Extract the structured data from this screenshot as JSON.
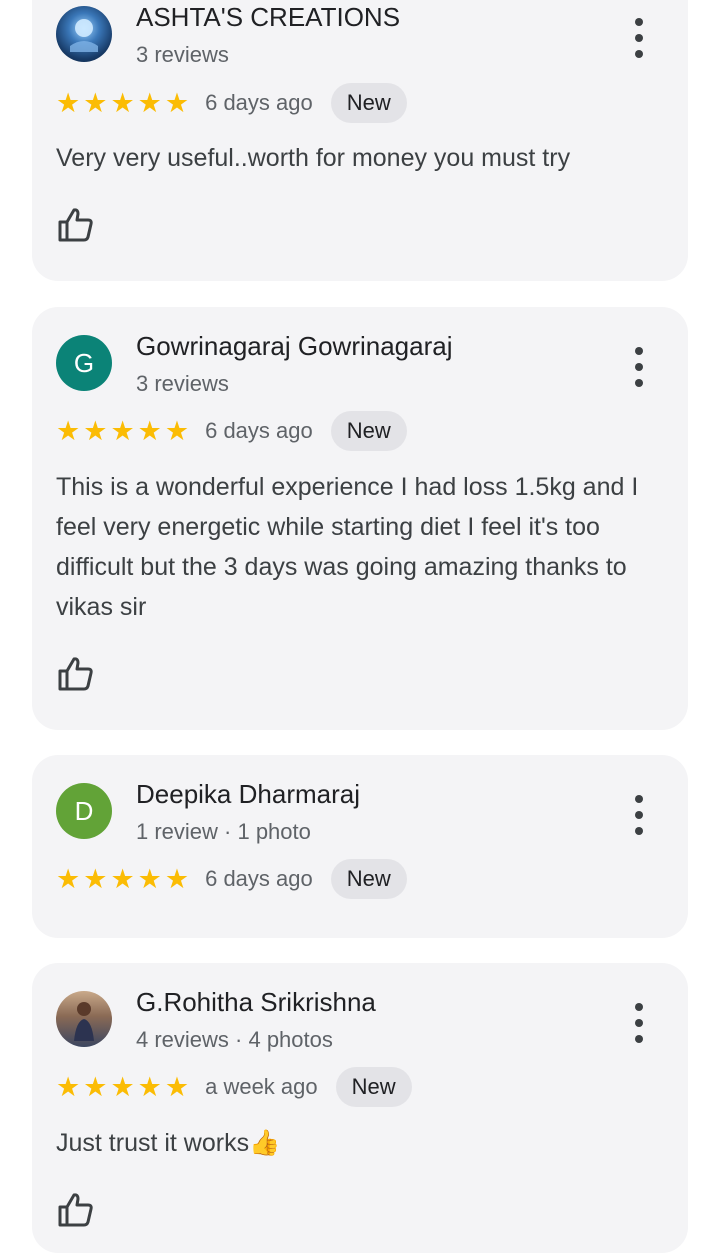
{
  "colors": {
    "star": "#fbbc04",
    "card_bg": "#f4f4f6",
    "badge_bg": "#e3e3e7",
    "avatar_g": "#0b8377",
    "avatar_d": "#62a337"
  },
  "reviews": [
    {
      "name": "ASHTA'S CREATIONS",
      "meta": "3 reviews",
      "avatar_type": "image",
      "avatar_letter": "",
      "stars": 5,
      "time": "6 days ago",
      "badge": "New",
      "text": "Very very useful..worth for money you must try"
    },
    {
      "name": "Gowrinagaraj Gowrinagaraj",
      "meta": "3 reviews",
      "avatar_type": "letter",
      "avatar_letter": "G",
      "stars": 5,
      "time": "6 days ago",
      "badge": "New",
      "text": "This is a wonderful experience I had loss 1.5kg and I feel very energetic while starting diet I feel it's too difficult but the 3 days was going amazing thanks to vikas sir"
    },
    {
      "name": "Deepika Dharmaraj",
      "meta": "1 review · 1 photo",
      "avatar_type": "letter",
      "avatar_letter": "D",
      "stars": 5,
      "time": "6 days ago",
      "badge": "New",
      "text": ""
    },
    {
      "name": "G.Rohitha Srikrishna",
      "meta": "4 reviews · 4 photos",
      "avatar_type": "image",
      "avatar_letter": "",
      "stars": 5,
      "time": "a week ago",
      "badge": "New",
      "text": "Just trust it works👍"
    }
  ],
  "icons": {
    "more": "more-vert-icon",
    "like": "thumb-up-outline-icon",
    "star": "star-icon"
  }
}
